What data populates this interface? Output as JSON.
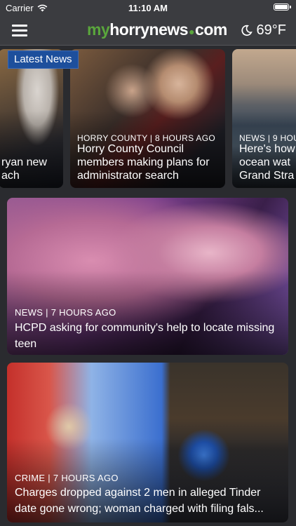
{
  "status_bar": {
    "carrier": "Carrier",
    "time": "11:10 AM"
  },
  "nav": {
    "logo_prefix": "my",
    "logo_main": "horrynews",
    "logo_suffix": "com",
    "weather_icon": "moon-icon",
    "temperature": "69°F"
  },
  "carousel": {
    "badge": "Latest News",
    "slides": [
      {
        "kicker": "",
        "headline_line1": "ryan new",
        "headline_line2": "ach"
      },
      {
        "kicker": "HORRY COUNTY | 8 HOURS AGO",
        "headline": "Horry County Council members making plans for administrator search"
      },
      {
        "kicker": "NEWS | 9 HOU",
        "headline_line1": "Here's how",
        "headline_line2": "ocean wat",
        "headline_line3": "Grand Stra"
      }
    ]
  },
  "stories": [
    {
      "kicker": "NEWS | 7 HOURS AGO",
      "headline": "HCPD asking for community's help to locate missing teen"
    },
    {
      "kicker": "CRIME | 7 HOURS AGO",
      "headline_line1": "Charges dropped against 2 men in alleged Tinder",
      "headline_line2": "date gone wrong; woman charged with filing fals..."
    }
  ],
  "colors": {
    "accent": "#1d4f9c",
    "brand_green": "#5aa63c",
    "nav_bg": "#3b3c40",
    "page_bg": "#2a2b2f"
  }
}
